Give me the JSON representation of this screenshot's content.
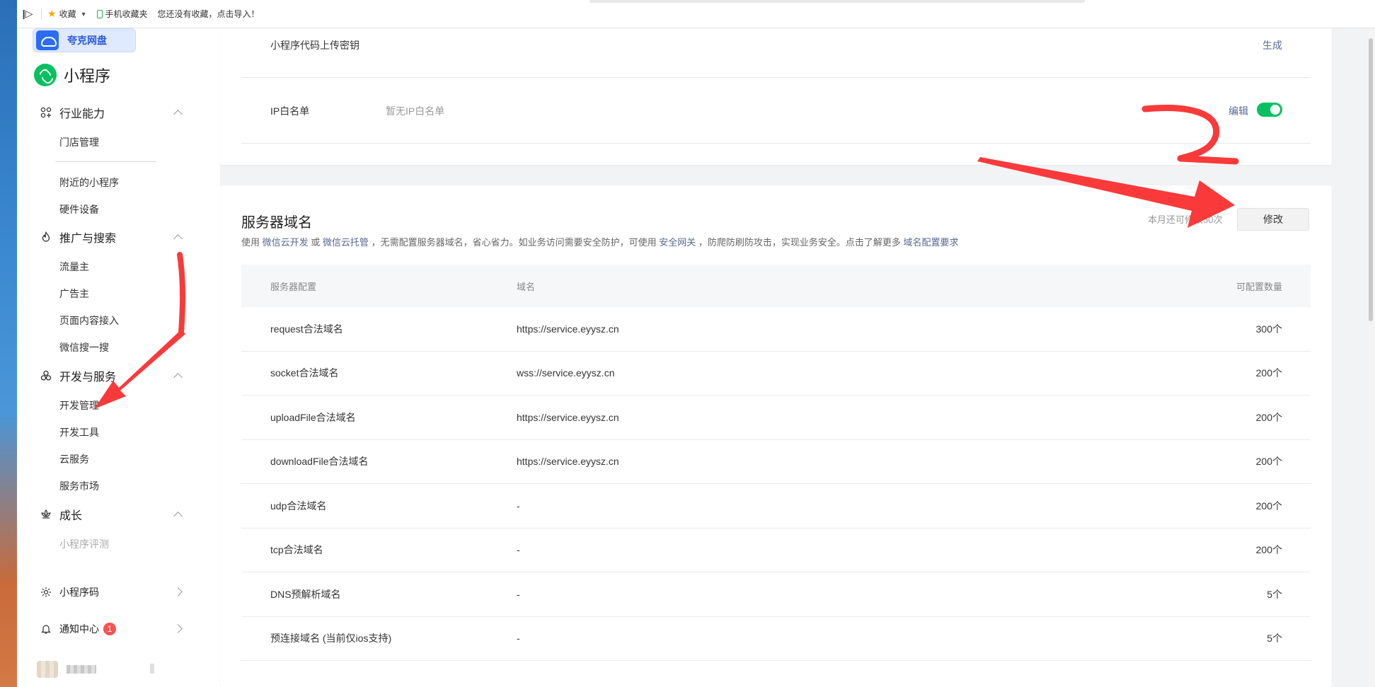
{
  "bookmarks": {
    "favorites_label": "收藏",
    "mobile_favorites_label": "手机收藏夹",
    "import_hint": "您还没有收藏，点击导入！"
  },
  "quark": {
    "label": "夸克网盘"
  },
  "brand": {
    "name": "小程序"
  },
  "sidebar": {
    "group_industry": "行业能力",
    "item_store": "门店管理",
    "item_nearby": "附近的小程序",
    "item_hardware": "硬件设备",
    "group_promo": "推广与搜索",
    "item_traffic": "流量主",
    "item_advertiser": "广告主",
    "item_content": "页面内容接入",
    "item_search": "微信搜一搜",
    "group_dev": "开发与服务",
    "item_dev_manage": "开发管理",
    "item_dev_tools": "开发工具",
    "item_cloud": "云服务",
    "item_market": "服务市场",
    "group_growth": "成长",
    "item_review": "小程序评测",
    "group_qrcode": "小程序码",
    "group_notice": "通知中心",
    "notice_count": "1"
  },
  "top_card": {
    "upload_key_label": "小程序代码上传密钥",
    "generate_link": "生成",
    "ip_label": "IP白名单",
    "ip_value": "暂无IP白名单",
    "edit_link": "编辑"
  },
  "server_domain": {
    "title": "服务器域名",
    "desc_1": "使用",
    "desc_link_1": "微信云开发",
    "desc_2": "或",
    "desc_link_2": "微信云托管",
    "desc_3": "，无需配置服务器域名，省心省力。如业务访问需要安全防护，可使用",
    "desc_link_3": "安全网关",
    "desc_4": "，防爬防刷防攻击，实现业务安全。点击了解更多",
    "desc_link_4": "域名配置要求",
    "remaining": "本月还可修改50次",
    "modify_button": "修改",
    "columns": [
      "服务器配置",
      "域名",
      "可配置数量"
    ],
    "rows": [
      {
        "config": "request合法域名",
        "domain": "https://service.eyysz.cn",
        "quota": "300个"
      },
      {
        "config": "socket合法域名",
        "domain": "wss://service.eyysz.cn",
        "quota": "200个"
      },
      {
        "config": "uploadFile合法域名",
        "domain": "https://service.eyysz.cn",
        "quota": "200个"
      },
      {
        "config": "downloadFile合法域名",
        "domain": "https://service.eyysz.cn",
        "quota": "200个"
      },
      {
        "config": "udp合法域名",
        "domain": "-",
        "quota": "200个"
      },
      {
        "config": "tcp合法域名",
        "domain": "-",
        "quota": "200个"
      },
      {
        "config": "DNS预解析域名",
        "domain": "-",
        "quota": "5个"
      },
      {
        "config": "预连接域名 (当前仅ios支持)",
        "domain": "-",
        "quota": "5个"
      }
    ]
  },
  "colors": {
    "accent_green": "#07c160",
    "link_blue": "#576b95",
    "annotation_red": "#fa3a3a",
    "badge_red": "#fa5151"
  }
}
